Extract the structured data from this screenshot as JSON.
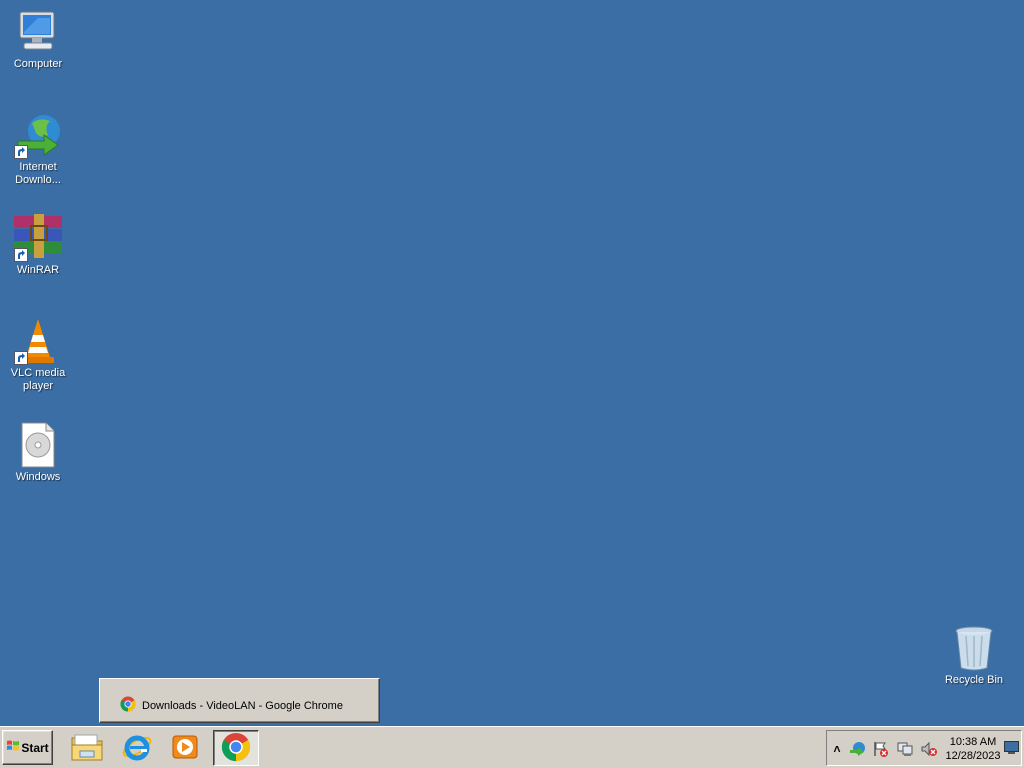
{
  "desktop": {
    "icons": [
      {
        "label": "Computer",
        "icon": "computer-icon"
      },
      {
        "label": "Internet Downlo...",
        "icon": "internet-download-manager-icon"
      },
      {
        "label": "WinRAR",
        "icon": "winrar-icon"
      },
      {
        "label": "VLC media player",
        "icon": "vlc-cone-icon"
      },
      {
        "label": "Windows",
        "icon": "disc-image-file-icon"
      },
      {
        "label": "Recycle Bin",
        "icon": "recycle-bin-icon"
      }
    ],
    "background_color": "#3a6ea5"
  },
  "taskbar": {
    "start_label": "Start",
    "pinned": [
      {
        "name": "windows-explorer",
        "icon": "folder-icon"
      },
      {
        "name": "internet-explorer",
        "icon": "ie-icon"
      },
      {
        "name": "windows-media-player",
        "icon": "media-player-icon"
      },
      {
        "name": "google-chrome",
        "icon": "chrome-icon",
        "active": true
      }
    ],
    "thumbnail": {
      "title": "Downloads - VideoLAN - Google Chrome"
    },
    "tray": {
      "expand_glyph": "˄",
      "icons": [
        "idm-tray-icon",
        "action-center-flag-icon",
        "network-icon",
        "volume-muted-icon"
      ],
      "time": "10:38 AM",
      "date": "12/28/2023"
    }
  }
}
